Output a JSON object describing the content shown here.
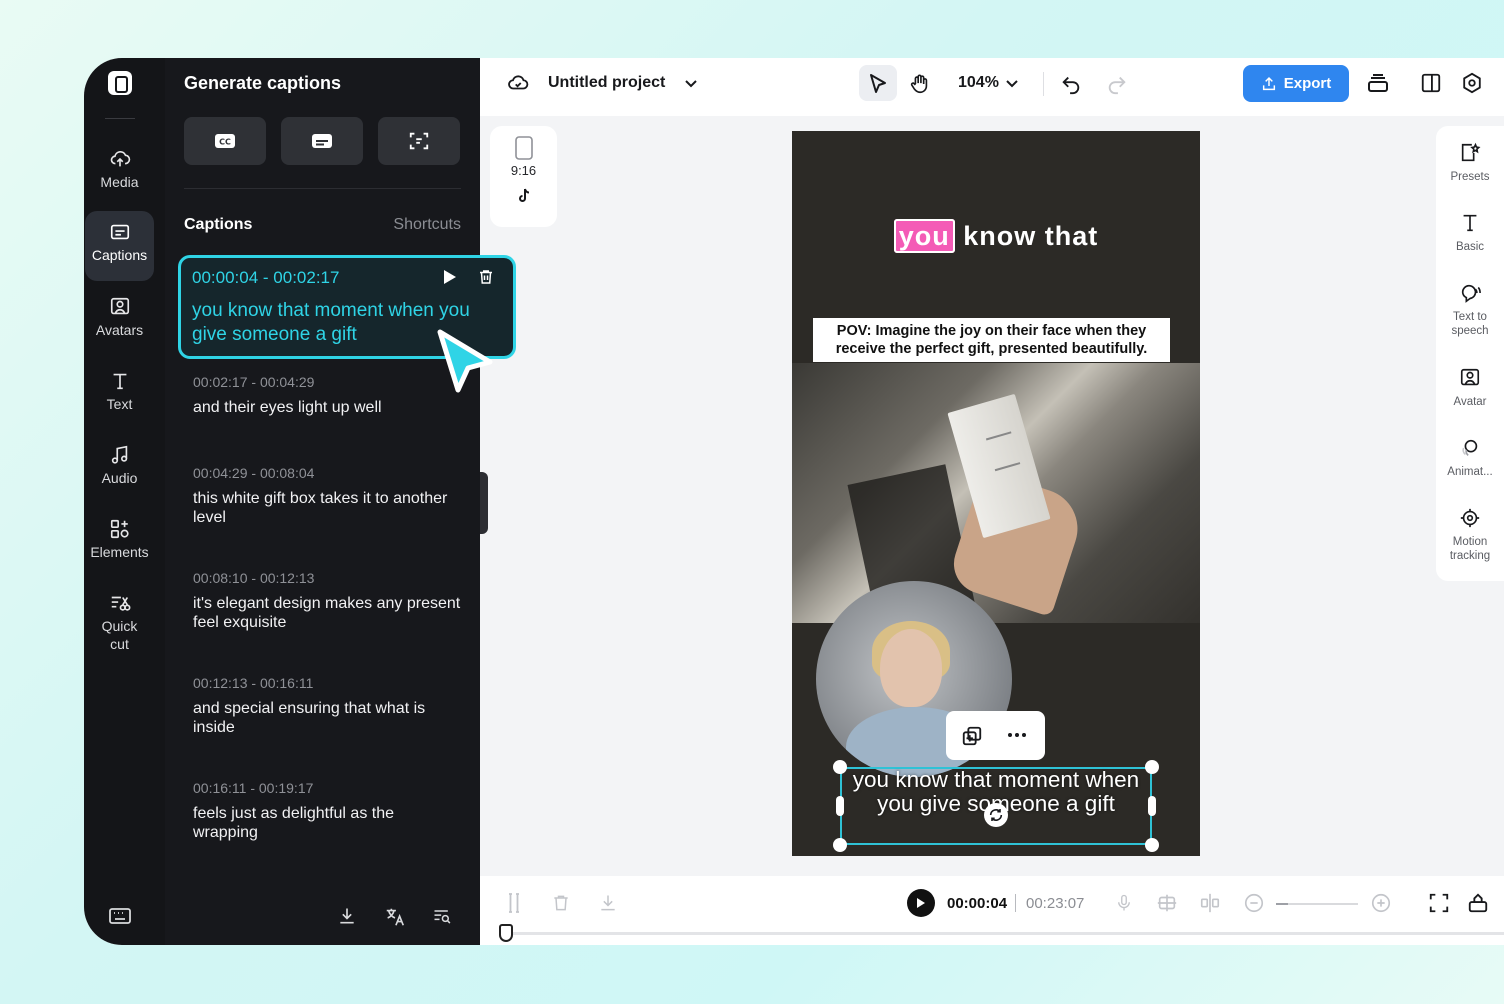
{
  "nav": {
    "items": [
      {
        "label": "Media",
        "icon": "cloud-upload-icon"
      },
      {
        "label": "Captions",
        "icon": "captions-icon",
        "active": true
      },
      {
        "label": "Avatars",
        "icon": "avatar-icon"
      },
      {
        "label": "Text",
        "icon": "text-icon"
      },
      {
        "label": "Audio",
        "icon": "music-note-icon"
      },
      {
        "label": "Elements",
        "icon": "elements-icon"
      },
      {
        "label": "Quick cut",
        "icon": "quick-cut-icon"
      }
    ]
  },
  "panel": {
    "title": "Generate captions",
    "captions_label": "Captions",
    "shortcuts_label": "Shortcuts",
    "active_caption": {
      "time": "00:00:04 - 00:02:17",
      "text": "you know that moment when you give someone a gift"
    },
    "captions": [
      {
        "time": "00:02:17 - 00:04:29",
        "text": "and their eyes light up well"
      },
      {
        "time": "00:04:29 - 00:08:04",
        "text": "this white gift box takes it to another level"
      },
      {
        "time": "00:08:10 - 00:12:13",
        "text": "it's elegant design makes any present feel exquisite"
      },
      {
        "time": "00:12:13 - 00:16:11",
        "text": "and special ensuring that what is inside"
      },
      {
        "time": "00:16:11 - 00:19:17",
        "text": "feels just as delightful as the wrapping"
      }
    ]
  },
  "topbar": {
    "project_name": "Untitled project",
    "zoom": "104%",
    "export_label": "Export"
  },
  "canvas": {
    "ratio": "9:16",
    "title_highlight": "you",
    "title_rest": "know that",
    "pov_text": "POV: Imagine the joy on their face when they receive the perfect gift, presented beautifully.",
    "subtitle": "you know that moment when you give someone a gift"
  },
  "right_panel": {
    "items": [
      {
        "label": "Presets"
      },
      {
        "label": "Basic"
      },
      {
        "label": "Text to speech"
      },
      {
        "label": "Avatar"
      },
      {
        "label": "Animat..."
      },
      {
        "label": "Motion tracking"
      }
    ]
  },
  "timeline": {
    "current_time": "00:00:04",
    "total_time": "00:23:07"
  },
  "colors": {
    "accent": "#2fd4e6",
    "export": "#2f86ef",
    "highlight": "#f45bb6"
  }
}
